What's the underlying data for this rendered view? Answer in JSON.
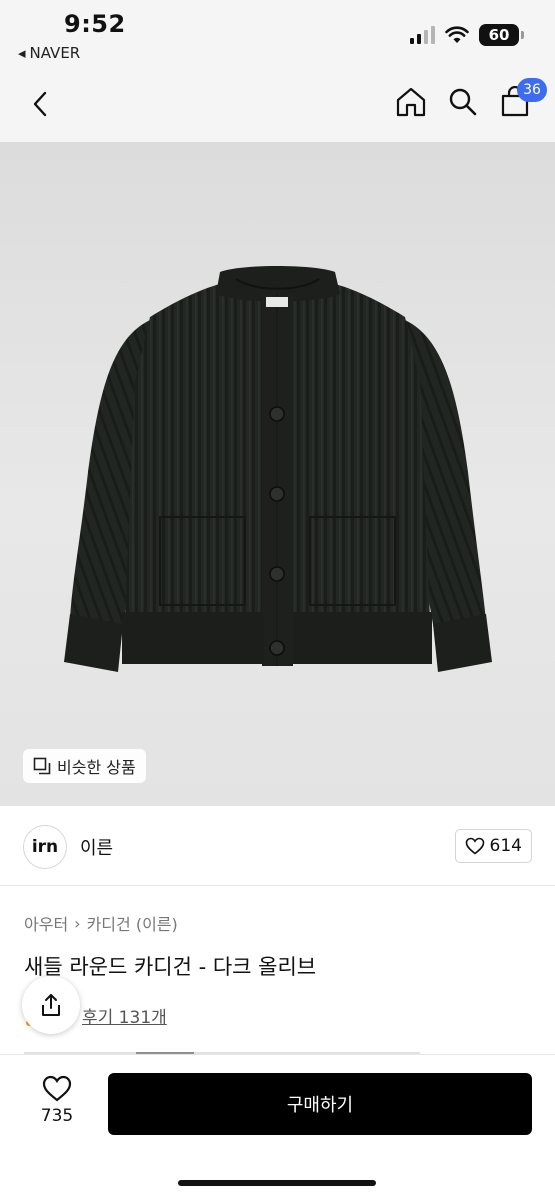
{
  "status_bar": {
    "time": "9:52",
    "back_app": "NAVER",
    "battery": "60"
  },
  "nav": {
    "back_icon": "chevron-left-icon",
    "home_icon": "home-icon",
    "search_icon": "search-icon",
    "cart_icon": "cart-icon",
    "cart_count": "36",
    "badge_color": "#3d6cf0"
  },
  "image": {
    "similar_label": "비슷한 상품"
  },
  "brand": {
    "logo_text": "irn",
    "name": "이른",
    "like_count": "614"
  },
  "product": {
    "breadcrumb": [
      "아우터",
      "카디건 (이른)"
    ],
    "title": "새들 라운드 카디건 - 다크 올리브",
    "review_text": "후기 131개"
  },
  "bottom": {
    "wish_count": "735",
    "buy_label": "구매하기"
  }
}
